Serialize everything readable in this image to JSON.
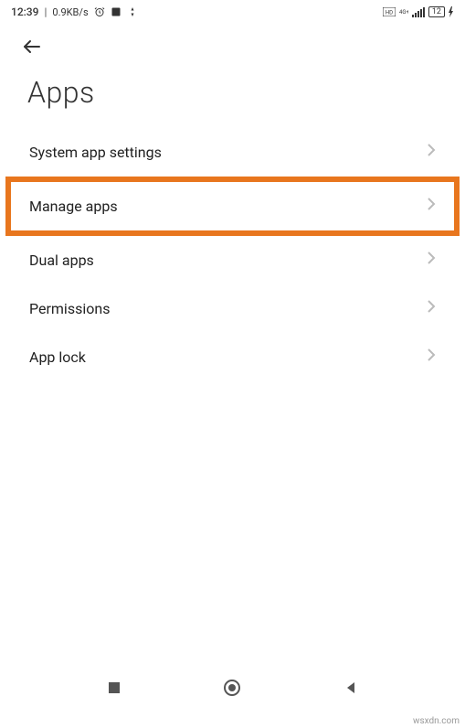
{
  "statusBar": {
    "time": "12:39",
    "separator": "|",
    "speed": "0.9KB/s",
    "battery": "12"
  },
  "header": {
    "title": "Apps"
  },
  "menu": {
    "items": [
      {
        "label": "System app settings"
      },
      {
        "label": "Manage apps"
      },
      {
        "label": "Dual apps"
      },
      {
        "label": "Permissions"
      },
      {
        "label": "App lock"
      }
    ]
  },
  "watermark": "wsxdn.com"
}
